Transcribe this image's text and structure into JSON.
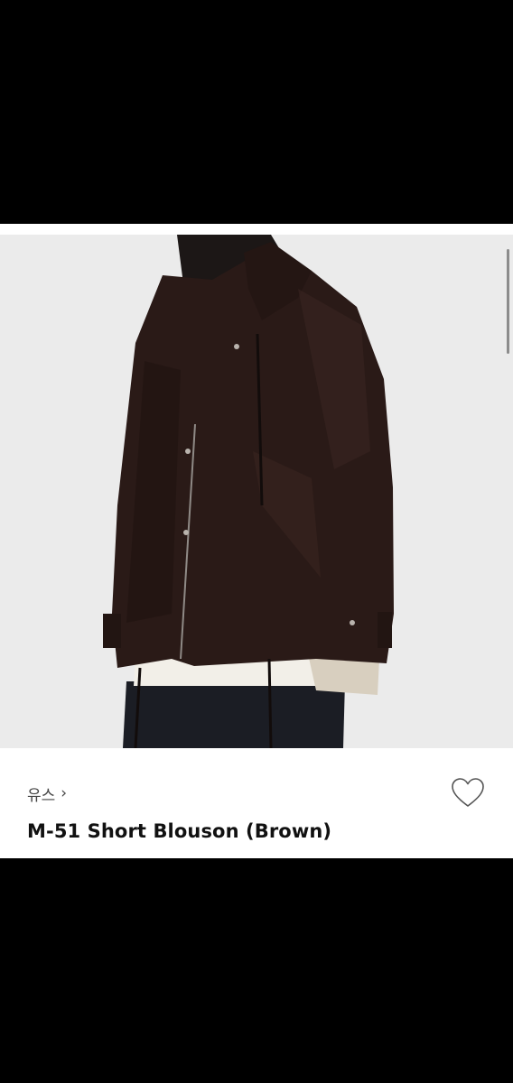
{
  "product": {
    "brand": "유스",
    "brand_chevron": "›",
    "title": "M-51 Short Blouson (Brown)",
    "image_icon": "product-photo",
    "wishlist_icon": "heart-outline-icon"
  },
  "colors": {
    "photo_background": "#ebebeb",
    "jacket": "#2a1a17",
    "text_primary": "#111111",
    "text_secondary": "#444444"
  }
}
